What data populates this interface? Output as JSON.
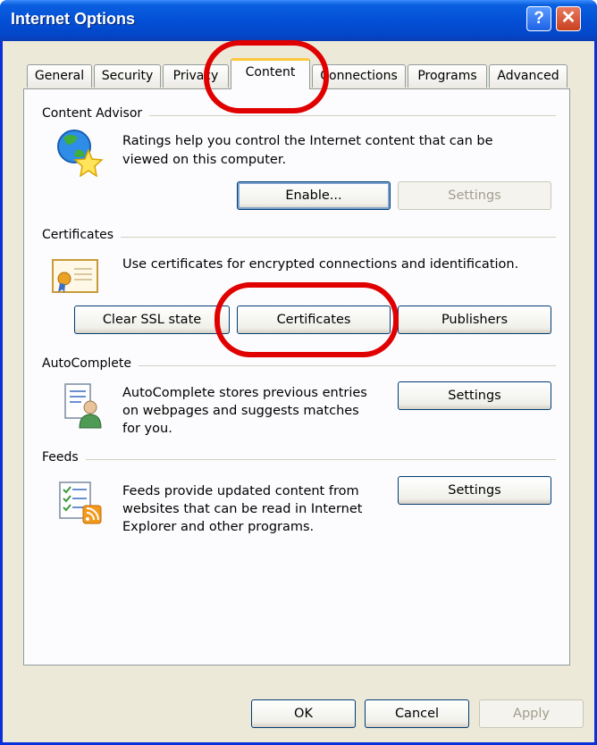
{
  "window": {
    "title": "Internet Options"
  },
  "titlebar_buttons": {
    "help": "?",
    "close": "✕"
  },
  "tabs": [
    {
      "label": "General"
    },
    {
      "label": "Security"
    },
    {
      "label": "Privacy"
    },
    {
      "label": "Content",
      "active": true
    },
    {
      "label": "Connections"
    },
    {
      "label": "Programs"
    },
    {
      "label": "Advanced"
    }
  ],
  "content_advisor": {
    "heading": "Content Advisor",
    "text_line1": "Ratings help you control the Internet content that can be",
    "text_line2": "viewed on this computer.",
    "enable_label": "Enable...",
    "settings_label": "Settings",
    "icon": "globe-star-icon"
  },
  "certificates": {
    "heading": "Certificates",
    "text": "Use certificates for encrypted connections and identification.",
    "clear_ssl_label": "Clear SSL state",
    "certificates_label": "Certificates",
    "publishers_label": "Publishers",
    "icon": "certificate-icon"
  },
  "autocomplete": {
    "heading": "AutoComplete",
    "text_line1": "AutoComplete stores previous entries",
    "text_line2": "on webpages and suggests matches",
    "text_line3": "for you.",
    "settings_label": "Settings",
    "icon": "user-form-icon"
  },
  "feeds": {
    "heading": "Feeds",
    "text_line1": "Feeds provide updated content from",
    "text_line2": "websites that can be read in Internet",
    "text_line3": "Explorer and other programs.",
    "settings_label": "Settings",
    "icon": "feed-list-icon"
  },
  "footer": {
    "ok_label": "OK",
    "cancel_label": "Cancel",
    "apply_label": "Apply"
  },
  "colors": {
    "title_bar": "#0450d6",
    "highlight": "#e00000",
    "active_tab_accent": "#ffc83c"
  }
}
